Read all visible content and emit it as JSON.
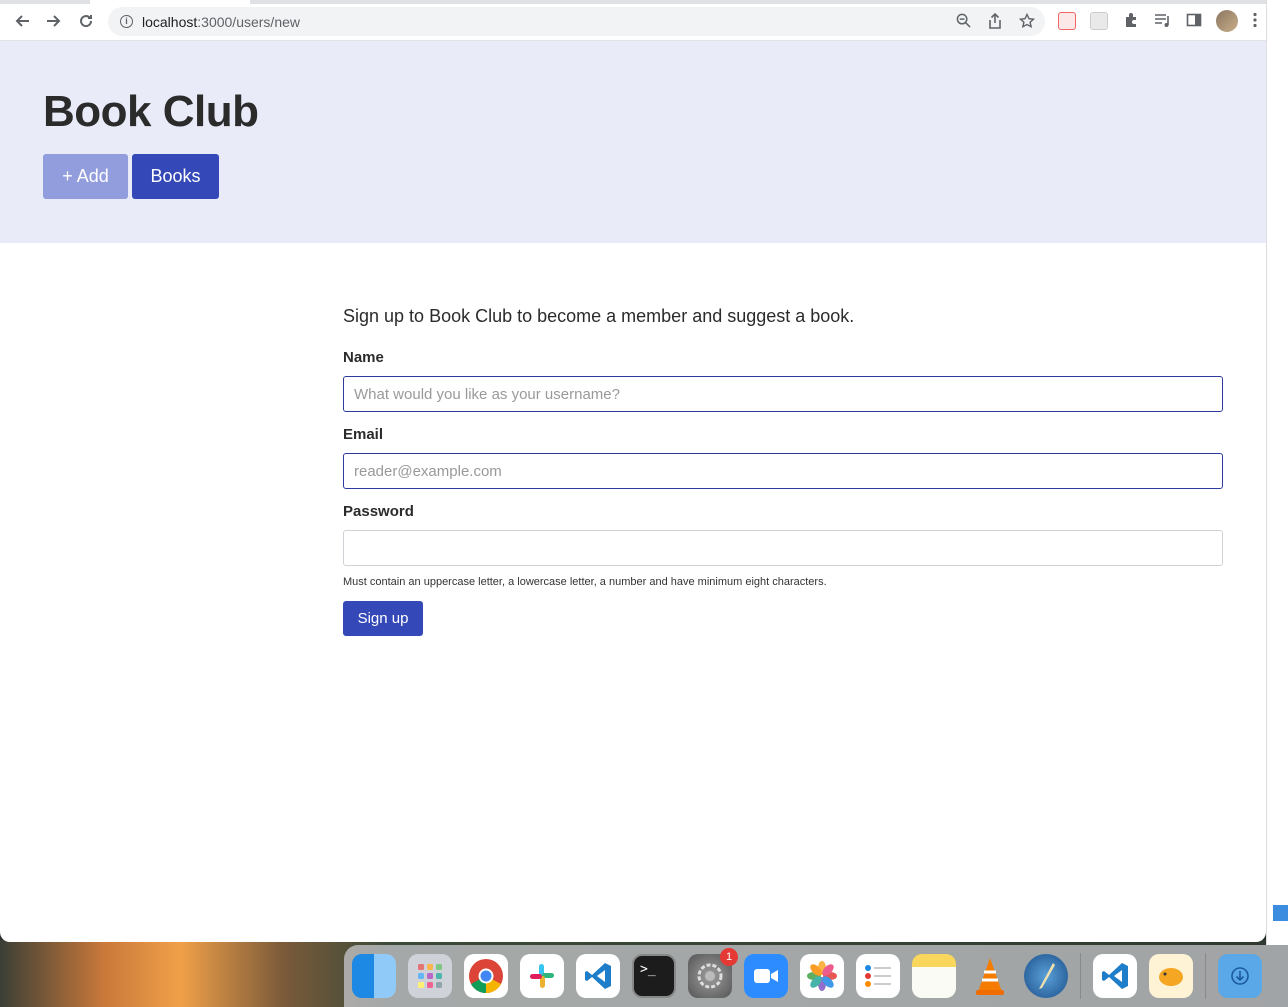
{
  "browser": {
    "url_host": "localhost",
    "url_path": ":3000/users/new"
  },
  "header": {
    "title": "Book Club",
    "add_button": "+ Add",
    "books_button": "Books"
  },
  "form": {
    "intro": "Sign up to Book Club to become a member and suggest a book.",
    "name_label": "Name",
    "name_placeholder": "What would you like as your username?",
    "email_label": "Email",
    "email_placeholder": "reader@example.com",
    "password_label": "Password",
    "password_value": "",
    "password_help": "Must contain an uppercase letter, a lowercase letter, a number and have minimum eight characters.",
    "submit": "Sign up"
  },
  "dock": {
    "apps": [
      "finder",
      "launchpad",
      "chrome",
      "slack",
      "vscode",
      "terminal",
      "system-preferences",
      "zoom",
      "photos",
      "reminders",
      "notes",
      "vlc",
      "quill",
      "vscode-2",
      "tableplus",
      "downloads"
    ],
    "system_preferences_badge": "1"
  },
  "colors": {
    "primary": "#3448b8",
    "primary_light": "#919ddc",
    "hero_bg": "#e9ebf9"
  }
}
